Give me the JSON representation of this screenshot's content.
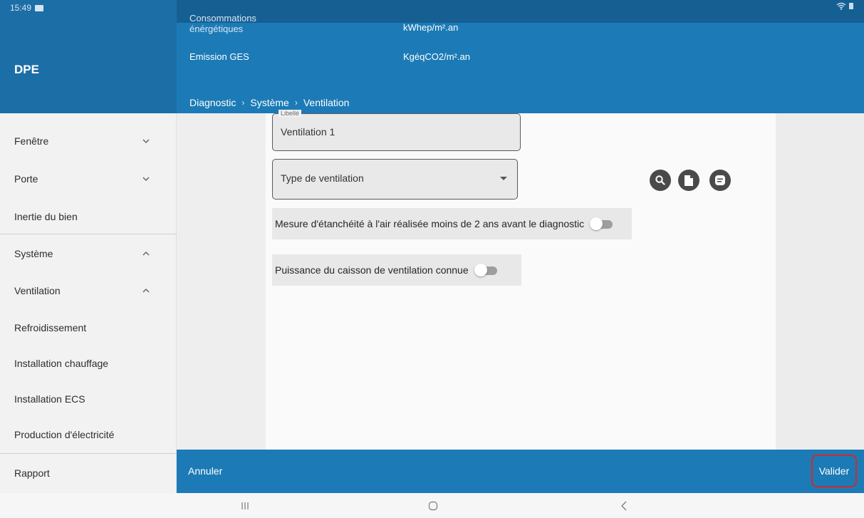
{
  "status_bar": {
    "time": "15:49"
  },
  "app": {
    "title": "DPE"
  },
  "header": {
    "consumption_label": "Consommations énérgétiques",
    "consumption_unit": "kWhep/m².an",
    "emission_label": "Emission GES",
    "emission_unit": "KgéqCO2/m².an"
  },
  "breadcrumb": [
    "Diagnostic",
    "Système",
    "Ventilation"
  ],
  "sidebar": {
    "items": [
      {
        "label": "Fenêtre",
        "chevron": "down"
      },
      {
        "label": "Porte",
        "chevron": "down"
      },
      {
        "label": "Inertie du bien"
      },
      {
        "label": "Système",
        "chevron": "up"
      },
      {
        "label": "Ventilation",
        "chevron": "up"
      },
      {
        "label": "Refroidissement"
      },
      {
        "label": "Installation chauffage"
      },
      {
        "label": "Installation ECS"
      },
      {
        "label": "Production d'électricité"
      },
      {
        "label": "Rapport"
      }
    ]
  },
  "form": {
    "libelle": {
      "label": "Libellé",
      "value": "Ventilation 1"
    },
    "type_ventilation": {
      "placeholder": "Type de ventilation"
    },
    "toggle_etancheite": {
      "label": "Mesure d'étanchéité à l'air réalisée moins de 2 ans avant le diagnostic",
      "checked": false
    },
    "toggle_puissance": {
      "label": "Puissance du caisson de ventilation connue",
      "checked": false
    }
  },
  "actions": {
    "icons": [
      "search-icon",
      "document-icon",
      "notes-icon"
    ]
  },
  "footer": {
    "cancel_label": "Annuler",
    "validate_label": "Valider"
  },
  "colors": {
    "primary": "#1c7bb6",
    "primary_dark": "#155f93",
    "highlight": "#d22a2a"
  }
}
